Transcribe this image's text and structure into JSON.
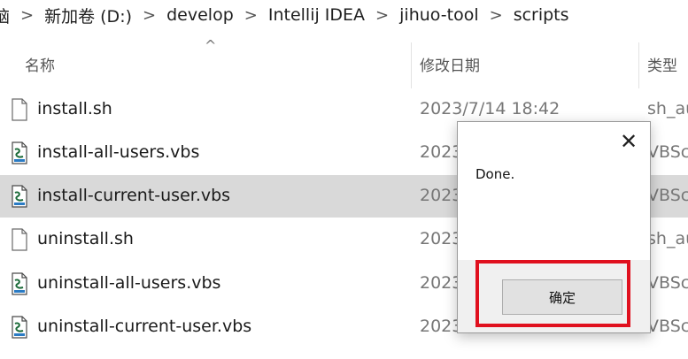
{
  "breadcrumb": {
    "items": [
      "脑",
      "新加卷 (D:)",
      "develop",
      "Intellij IDEA",
      "jihuo-tool",
      "scripts"
    ],
    "separator": ">"
  },
  "columns": {
    "name": "名称",
    "date": "修改日期",
    "type": "类型"
  },
  "files": [
    {
      "name": "install.sh",
      "date": "2023/7/14 18:42",
      "type": "sh_au",
      "icon": "blank-file-icon",
      "selected": false
    },
    {
      "name": "install-all-users.vbs",
      "date": "2023",
      "type": "VBScr",
      "icon": "vbs-script-icon",
      "selected": false
    },
    {
      "name": "install-current-user.vbs",
      "date": "2023",
      "type": "VBScr",
      "icon": "vbs-script-icon",
      "selected": true
    },
    {
      "name": "uninstall.sh",
      "date": "2023",
      "type": "sh_au",
      "icon": "blank-file-icon",
      "selected": false
    },
    {
      "name": "uninstall-all-users.vbs",
      "date": "2023",
      "type": "VBScr",
      "icon": "vbs-script-icon",
      "selected": false
    },
    {
      "name": "uninstall-current-user.vbs",
      "date": "2023",
      "type": "VBScr",
      "icon": "vbs-script-icon",
      "selected": false
    }
  ],
  "dialog": {
    "message": "Done.",
    "ok_label": "确定",
    "close_icon": "close-icon"
  },
  "colors": {
    "selection": "#d9d9d9",
    "highlight": "#e0101e",
    "footer": "#f0f0f0"
  }
}
